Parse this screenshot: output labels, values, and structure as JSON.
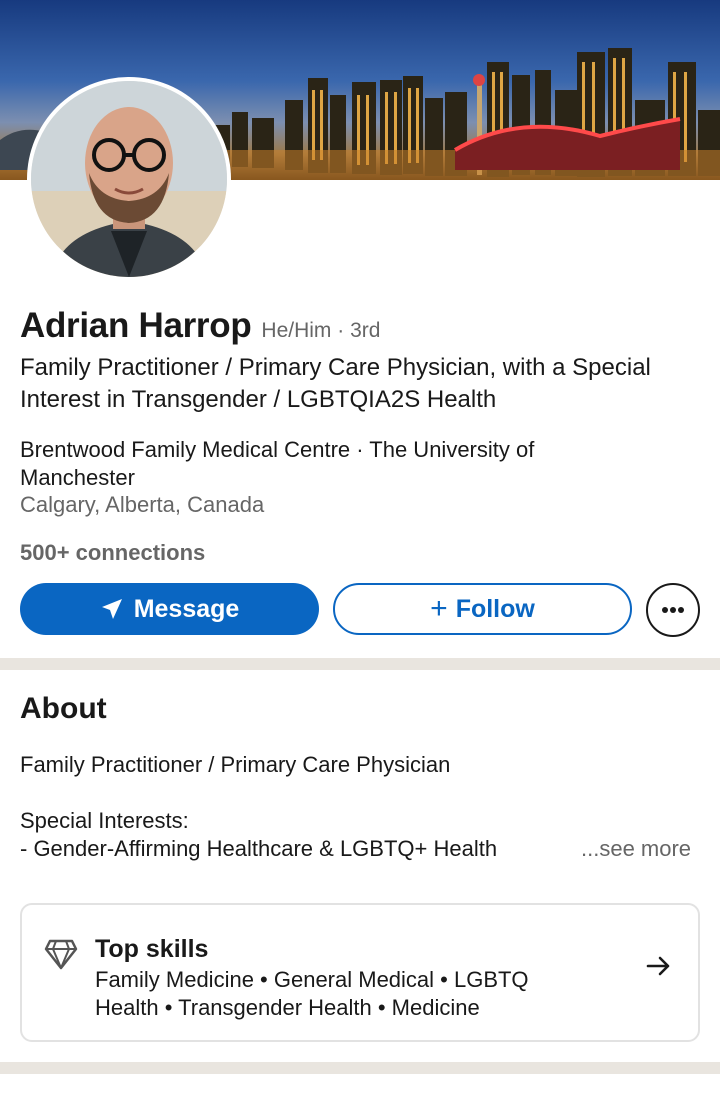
{
  "banner": {
    "image": "city-skyline-at-night",
    "colors": {
      "sky": "#2f5fa9",
      "lights": "#f3b54a",
      "stadium_roof": "#d9323a"
    }
  },
  "profile": {
    "avatar": "profile-photo",
    "name": "Adrian Harrop",
    "pronouns_degree": "He/Him · 3rd",
    "headline": "Family Practitioner / Primary Care Physician, with a Special Interest in Transgender / LGBTQIA2S Health",
    "workplace": "Brentwood Family Medical Centre · The University of Manchester",
    "location": "Calgary, Alberta, Canada",
    "connections": "500+ connections"
  },
  "actions": {
    "message_label": "Message",
    "message_icon": "paper-plane-icon",
    "follow_label": "Follow",
    "follow_icon": "+",
    "more_icon": "ellipsis-icon"
  },
  "about": {
    "title": "About",
    "line1": "Family Practitioner / Primary Care Physician",
    "line2": "Special Interests:",
    "line3": "- Gender-Affirming Healthcare & LGBTQ+ Health",
    "see_more": "...see more"
  },
  "top_skills": {
    "icon": "diamond-icon",
    "title": "Top skills",
    "skills": "Family Medicine • General Medical • LGBTQ Health • Transgender Health • Medicine",
    "arrow": "arrow-right-icon"
  },
  "colors": {
    "primary": "#0a66c2",
    "divider": "#e9e5df",
    "muted_text": "#666666"
  }
}
